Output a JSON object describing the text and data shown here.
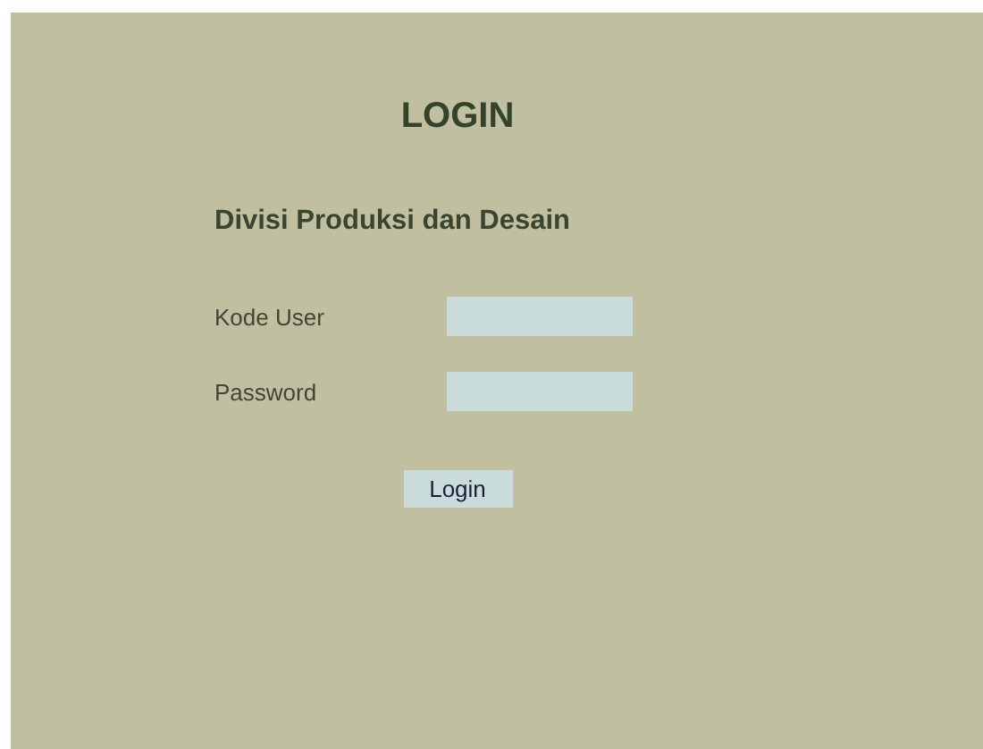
{
  "title": "LOGIN",
  "subtitle": "Divisi Produksi dan Desain",
  "fields": [
    {
      "label": "Kode User"
    },
    {
      "label": "Password"
    }
  ],
  "button": "Login"
}
